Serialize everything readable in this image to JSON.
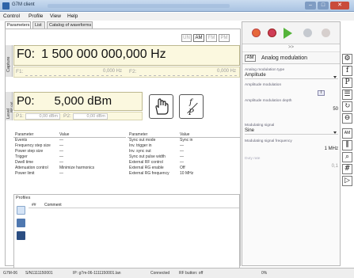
{
  "window": {
    "title": "G7M client"
  },
  "menu": [
    "Control",
    "Profile",
    "View",
    "Help"
  ],
  "tabs": [
    "Parameters",
    "List",
    "Catalog of waveforms"
  ],
  "modulation_buttons": [
    "UN",
    "AM",
    "FM",
    "PM"
  ],
  "side_tabs": {
    "capture": "Capture",
    "level": "Level",
    "rf_out": "RF out"
  },
  "frequency": {
    "label": "F0:",
    "parts": [
      "1",
      "500",
      "000",
      "000,000"
    ],
    "unit": "Hz",
    "f1_label": "F1:",
    "f1_value": "0,000 Hz",
    "f2_label": "F2:",
    "f2_value": "0,000 Hz"
  },
  "power": {
    "label": "P0:",
    "value": "5,000 dBm",
    "p1_label": "P1:",
    "p1_value": "0,00 dBm",
    "p2_label": "P2:",
    "p2_value": "0,00 dBm"
  },
  "params_left": {
    "headers": [
      "Parameter",
      "Value"
    ],
    "rows": [
      [
        "Events",
        "—"
      ],
      [
        "Frequency step size",
        "—"
      ],
      [
        "Power step size",
        "—"
      ],
      [
        "Trigger",
        "—"
      ],
      [
        "Dwell time",
        "—"
      ],
      [
        "Attenuation control",
        "Minimize harmonics"
      ],
      [
        "Power limit",
        "—"
      ]
    ]
  },
  "params_right": {
    "headers": [
      "Parameter",
      "Value"
    ],
    "rows": [
      [
        "Sync out mode",
        "Sync in"
      ],
      [
        "Inv. trigger in",
        "—"
      ],
      [
        "Inv. sync out",
        "—"
      ],
      [
        "Sync out pulse width",
        "—"
      ],
      [
        "External RF control",
        "—"
      ],
      [
        "External RG enable",
        "Off"
      ],
      [
        "External RG frequency",
        "10 MHz"
      ]
    ]
  },
  "profiles": {
    "label": "Profiles",
    "col_num": "##",
    "col_comment": "Comment"
  },
  "right_panel": {
    "expander": ">>",
    "am_badge": "AM",
    "title": "Analog modulation",
    "type_label": "Analog modulation type",
    "type_value": "Amplitude",
    "am_label": "Amplitude modulation",
    "am_input": "I",
    "depth_label": "Amplitude modulation depth",
    "depth_value": "50",
    "signal_label": "Modulating signal",
    "signal_value": "Sine",
    "sigfreq_label": "Modulating signal frequency",
    "sigfreq_value": "1 MHz",
    "duty_label": "Duty rate",
    "duty_value": "0,1"
  },
  "side_icons": [
    "⚙",
    "f",
    "P",
    "☰",
    "↻",
    "⊖",
    "AM",
    "⫼",
    "⌕",
    "#",
    "▷"
  ],
  "status": {
    "device": "G7M-06",
    "serial": "S/N1111150001",
    "ip": "IP: g7m-06-1111150001.lan",
    "connection": "Connected",
    "rf": "RF button: off",
    "progress": "0%"
  }
}
